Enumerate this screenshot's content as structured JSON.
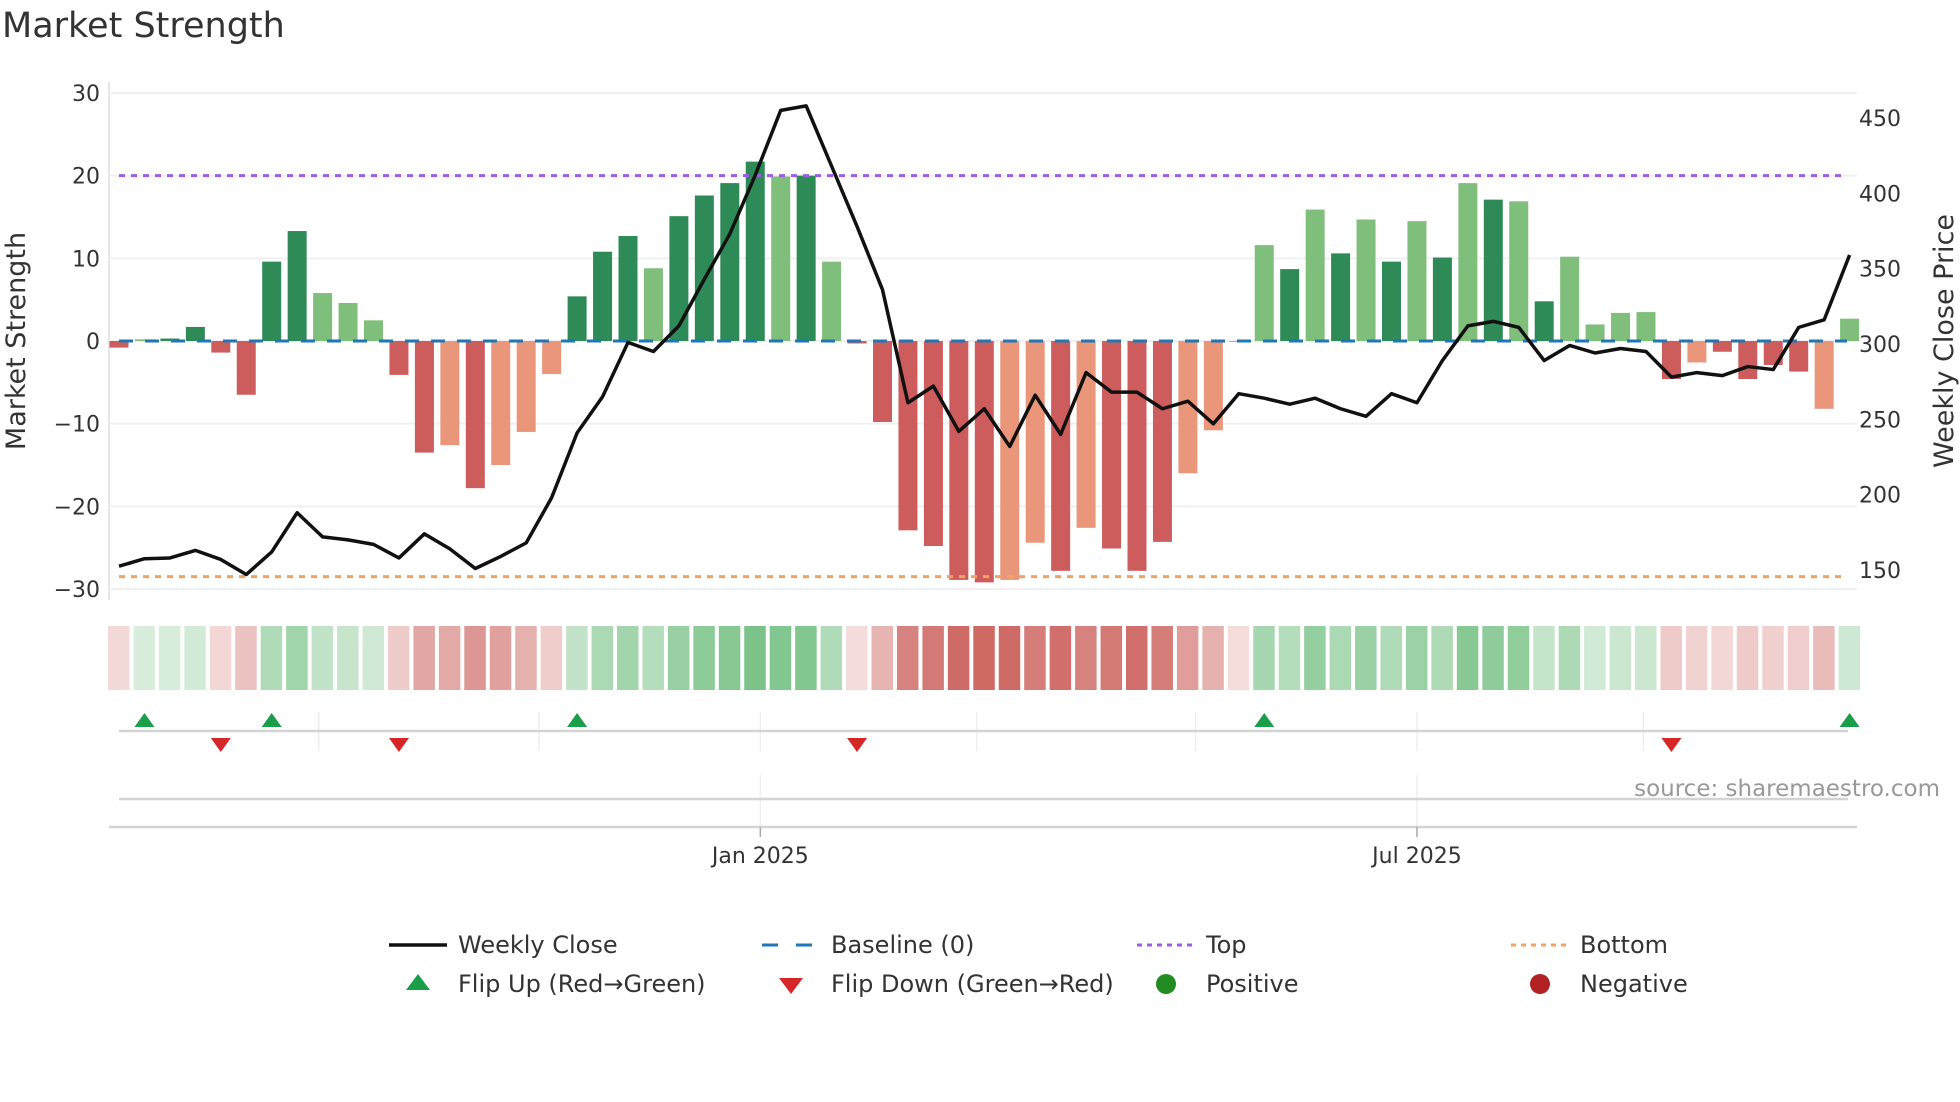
{
  "title": "Market Strength",
  "source_text": "source: sharemaestro.com",
  "chart_data": {
    "type": "bar+line",
    "title": "Market Strength",
    "ylabel_left": "Market Strength",
    "ylabel_right": "Weekly Close Price",
    "ylim_left": [
      -31,
      31
    ],
    "ylim_right": [
      134,
      466
    ],
    "yticks_left": [
      30,
      20,
      10,
      0,
      -10,
      -20,
      -30
    ],
    "yticks_left_labels": [
      "30",
      "20",
      "10",
      "0",
      "−10",
      "−20",
      "−30"
    ],
    "yticks_right": [
      450,
      400,
      350,
      300,
      250,
      200,
      150
    ],
    "yticks_right_labels": [
      "450",
      "400",
      "350",
      "300",
      "250",
      "200",
      "150"
    ],
    "xticks": [
      {
        "label": "Jan 2025",
        "week_index": 25.2
      },
      {
        "label": "Jul 2025",
        "week_index": 51.0
      }
    ],
    "month_gridlines_week_index": [
      7.85,
      16.5,
      25.2,
      33.7,
      42.3,
      51.0,
      59.9
    ],
    "top_level": 20,
    "bottom_level": -28.5,
    "baseline": 0,
    "strength": [
      -0.8,
      0.2,
      0.3,
      1.7,
      -1.4,
      -6.5,
      9.6,
      13.3,
      5.8,
      4.6,
      2.5,
      -4.1,
      -13.5,
      -12.6,
      -17.8,
      -15.0,
      -11.0,
      -4.0,
      5.4,
      10.8,
      12.7,
      8.8,
      15.1,
      17.6,
      19.1,
      21.7,
      19.9,
      20.0,
      9.6,
      -0.3,
      -9.8,
      -22.9,
      -24.8,
      -28.9,
      -29.2,
      -28.9,
      -24.4,
      -27.8,
      -22.6,
      -25.1,
      -27.8,
      -24.3,
      -16.0,
      -10.8,
      -0.1,
      11.6,
      8.7,
      15.9,
      10.6,
      14.7,
      9.6,
      14.5,
      10.1,
      19.1,
      17.1,
      16.9,
      4.8,
      10.2,
      2.0,
      3.4,
      3.5,
      -4.6,
      -2.6,
      -1.3,
      -4.6,
      -2.9,
      -3.7,
      -8.2,
      2.7
    ],
    "shade": "dlddddddlllddldllldddlddddldlddddddlldldddlllldldldldldldlllldlddddlldldddd",
    "weekly_close": [
      152.5,
      157.5,
      158,
      163,
      157,
      147,
      162,
      188,
      172,
      170,
      167,
      158,
      174,
      164,
      151,
      159,
      168,
      198,
      241,
      265,
      301,
      295,
      312,
      343,
      373,
      412,
      455,
      458,
      418,
      378,
      336,
      261,
      272,
      242,
      257,
      232,
      266,
      240,
      281,
      268,
      268,
      257,
      262,
      247,
      267,
      264,
      260,
      264,
      257,
      252,
      267,
      261,
      289,
      312,
      315,
      311,
      289,
      299,
      294,
      297,
      295,
      278,
      281,
      279,
      285,
      283,
      311,
      316,
      359
    ],
    "flip_up_indices": [
      1,
      6,
      18,
      45,
      68
    ],
    "flip_down_indices": [
      4,
      11,
      29,
      61
    ],
    "legend": [
      {
        "label": "Weekly Close",
        "kind": "line"
      },
      {
        "label": "Baseline (0)",
        "kind": "dash"
      },
      {
        "label": "Top",
        "kind": "dot-top"
      },
      {
        "label": "Bottom",
        "kind": "dot-bottom"
      },
      {
        "label": "Flip Up (Red→Green)",
        "kind": "tri-up"
      },
      {
        "label": "Flip Down (Green→Red)",
        "kind": "tri-down"
      },
      {
        "label": "Positive",
        "kind": "dot-pos"
      },
      {
        "label": "Negative",
        "kind": "dot-neg"
      }
    ],
    "legend_placement": "bottom"
  },
  "colors": {
    "pos_strong": "#2e8b57",
    "pos_weak": "#7fbf7b",
    "neg_strong": "#cd5c5c",
    "neg_weak": "#e9967a",
    "close_line": "#111111",
    "baseline": "#1f77b4",
    "top": "#9b5de5",
    "bottom": "#f4a261",
    "flip_up": "#1a9e4a",
    "flip_down": "#d62728",
    "positive": "#228b22",
    "negative": "#b22222"
  }
}
